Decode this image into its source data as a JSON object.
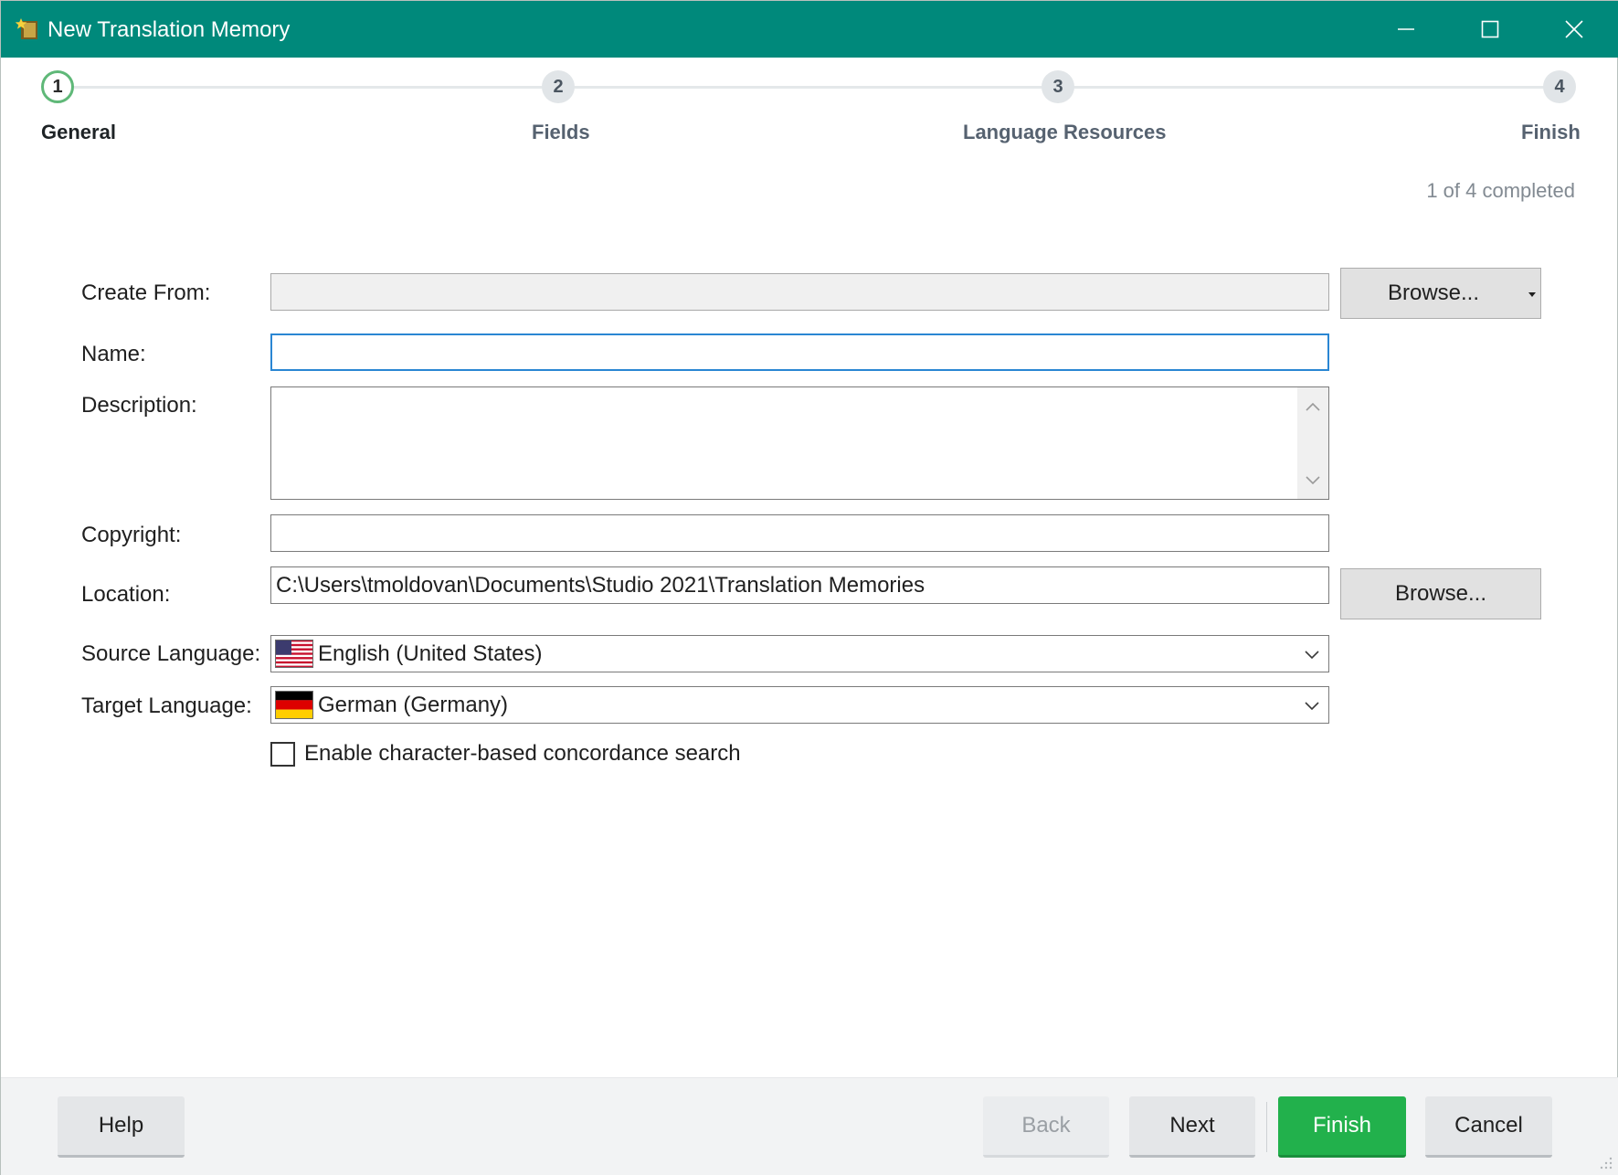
{
  "window": {
    "title": "New Translation Memory",
    "accent_color": "#00897b",
    "icons": [
      "app-star-icon",
      "minimize-icon",
      "maximize-icon",
      "close-icon"
    ]
  },
  "wizard": {
    "steps": [
      {
        "number": "1",
        "label": "General",
        "state": "active"
      },
      {
        "number": "2",
        "label": "Fields",
        "state": "pending"
      },
      {
        "number": "3",
        "label": "Language Resources",
        "state": "pending"
      },
      {
        "number": "4",
        "label": "Finish",
        "state": "pending"
      }
    ],
    "progress_text": "1 of 4 completed",
    "completed": 1,
    "total": 4
  },
  "form": {
    "create_from": {
      "label": "Create From:",
      "value": "",
      "browse_label": "Browse..."
    },
    "name": {
      "label": "Name:",
      "value": ""
    },
    "description": {
      "label": "Description:",
      "value": ""
    },
    "copyright": {
      "label": "Copyright:",
      "value": ""
    },
    "location": {
      "label": "Location:",
      "value": "C:\\Users\\tmoldovan\\Documents\\Studio 2021\\Translation Memories",
      "browse_label": "Browse..."
    },
    "source_language": {
      "label": "Source Language:",
      "value": "English (United States)",
      "flag": "us-flag-icon"
    },
    "target_language": {
      "label": "Target Language:",
      "value": "German (Germany)",
      "flag": "de-flag-icon"
    },
    "concordance": {
      "label": "Enable character-based concordance search",
      "checked": false
    }
  },
  "footer": {
    "help_label": "Help",
    "back_label": "Back",
    "next_label": "Next",
    "finish_label": "Finish",
    "cancel_label": "Cancel",
    "finish_color": "#22b14c"
  }
}
